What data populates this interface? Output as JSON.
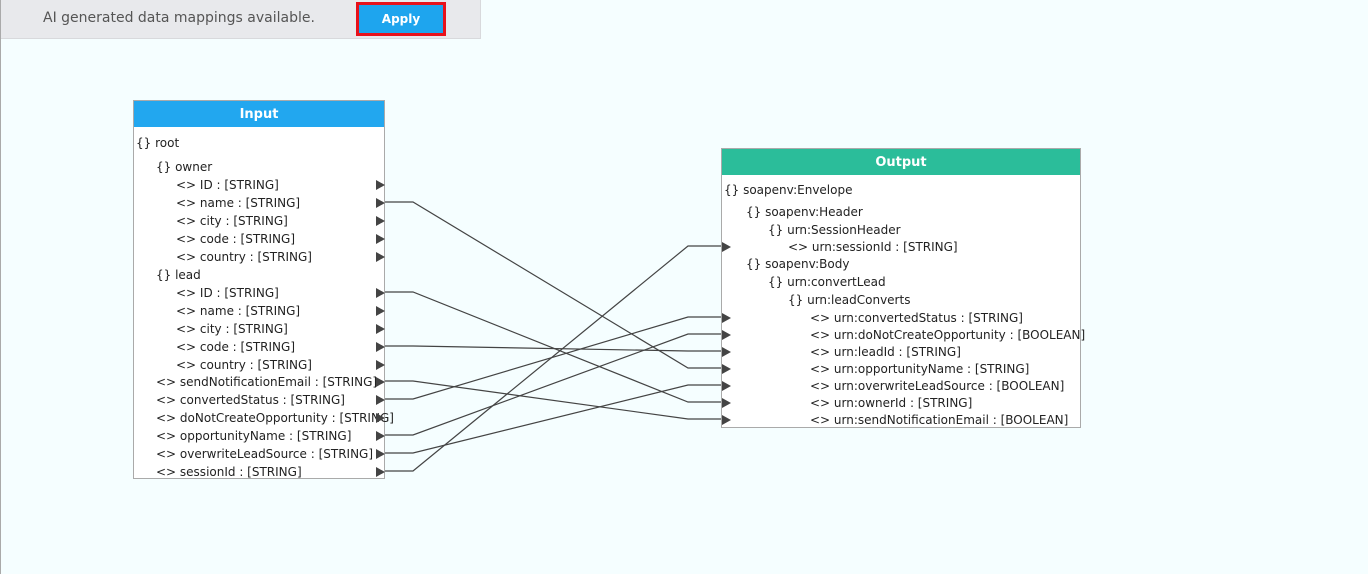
{
  "banner": {
    "message": "AI generated data mappings available.",
    "apply_label": "Apply"
  },
  "colors": {
    "input_header": "#22a7ef",
    "output_header": "#2bbd9a",
    "apply_bg": "#1ea5ee",
    "apply_border": "#e8121b",
    "link": "#444444"
  },
  "input": {
    "title": "Input",
    "rows": [
      {
        "text": "{}  root",
        "indent": 0,
        "port": false
      },
      {
        "text": "{}  owner",
        "indent": 1,
        "port": false
      },
      {
        "text": "<> ID  : [STRING]",
        "indent": 2,
        "port": true
      },
      {
        "text": "<> name  : [STRING]",
        "indent": 2,
        "port": true
      },
      {
        "text": "<> city  : [STRING]",
        "indent": 2,
        "port": true
      },
      {
        "text": "<> code  : [STRING]",
        "indent": 2,
        "port": true
      },
      {
        "text": "<> country  : [STRING]",
        "indent": 2,
        "port": true
      },
      {
        "text": "{}  lead",
        "indent": 1,
        "port": false
      },
      {
        "text": "<> ID  : [STRING]",
        "indent": 2,
        "port": true
      },
      {
        "text": "<> name  : [STRING]",
        "indent": 2,
        "port": true
      },
      {
        "text": "<> city  : [STRING]",
        "indent": 2,
        "port": true
      },
      {
        "text": "<> code  : [STRING]",
        "indent": 2,
        "port": true
      },
      {
        "text": "<> country  : [STRING]",
        "indent": 2,
        "port": true
      },
      {
        "text": "<> sendNotificationEmail  : [STRING]",
        "indent": 1,
        "port": true
      },
      {
        "text": "<> convertedStatus  : [STRING]",
        "indent": 1,
        "port": true
      },
      {
        "text": "<> doNotCreateOpportunity  : [STRING]",
        "indent": 1,
        "port": true
      },
      {
        "text": "<> opportunityName  : [STRING]",
        "indent": 1,
        "port": true
      },
      {
        "text": "<> overwriteLeadSource  : [STRING]",
        "indent": 1,
        "port": true
      },
      {
        "text": "<> sessionId  : [STRING]",
        "indent": 1,
        "port": true
      }
    ]
  },
  "output": {
    "title": "Output",
    "rows": [
      {
        "text": "{}  soapenv:Envelope",
        "indent": 0,
        "port": false
      },
      {
        "text": "{}  soapenv:Header",
        "indent": 1,
        "port": false
      },
      {
        "text": "{}  urn:SessionHeader",
        "indent": 2,
        "port": false
      },
      {
        "text": "<> urn:sessionId  : [STRING]",
        "indent": 3,
        "port": true
      },
      {
        "text": "{}  soapenv:Body",
        "indent": 1,
        "port": false
      },
      {
        "text": "{}  urn:convertLead",
        "indent": 2,
        "port": false
      },
      {
        "text": "{}  urn:leadConverts",
        "indent": 3,
        "port": false
      },
      {
        "text": "<> urn:convertedStatus  : [STRING]",
        "indent": 4,
        "port": true
      },
      {
        "text": "<> urn:doNotCreateOpportunity  : [BOOLEAN]",
        "indent": 4,
        "port": true
      },
      {
        "text": "<> urn:leadId  : [STRING]",
        "indent": 4,
        "port": true
      },
      {
        "text": "<> urn:opportunityName  : [STRING]",
        "indent": 4,
        "port": true
      },
      {
        "text": "<> urn:overwriteLeadSource  : [BOOLEAN]",
        "indent": 4,
        "port": true
      },
      {
        "text": "<> urn:ownerId  : [STRING]",
        "indent": 4,
        "port": true
      },
      {
        "text": "<> urn:sendNotificationEmail  : [BOOLEAN]",
        "indent": 4,
        "port": true
      }
    ]
  },
  "mappings": [
    {
      "from": 3,
      "to": 10
    },
    {
      "from": 8,
      "to": 12
    },
    {
      "from": 11,
      "to": 9
    },
    {
      "from": 13,
      "to": 13
    },
    {
      "from": 14,
      "to": 7
    },
    {
      "from": 16,
      "to": 8
    },
    {
      "from": 17,
      "to": 11
    },
    {
      "from": 18,
      "to": 3
    }
  ]
}
